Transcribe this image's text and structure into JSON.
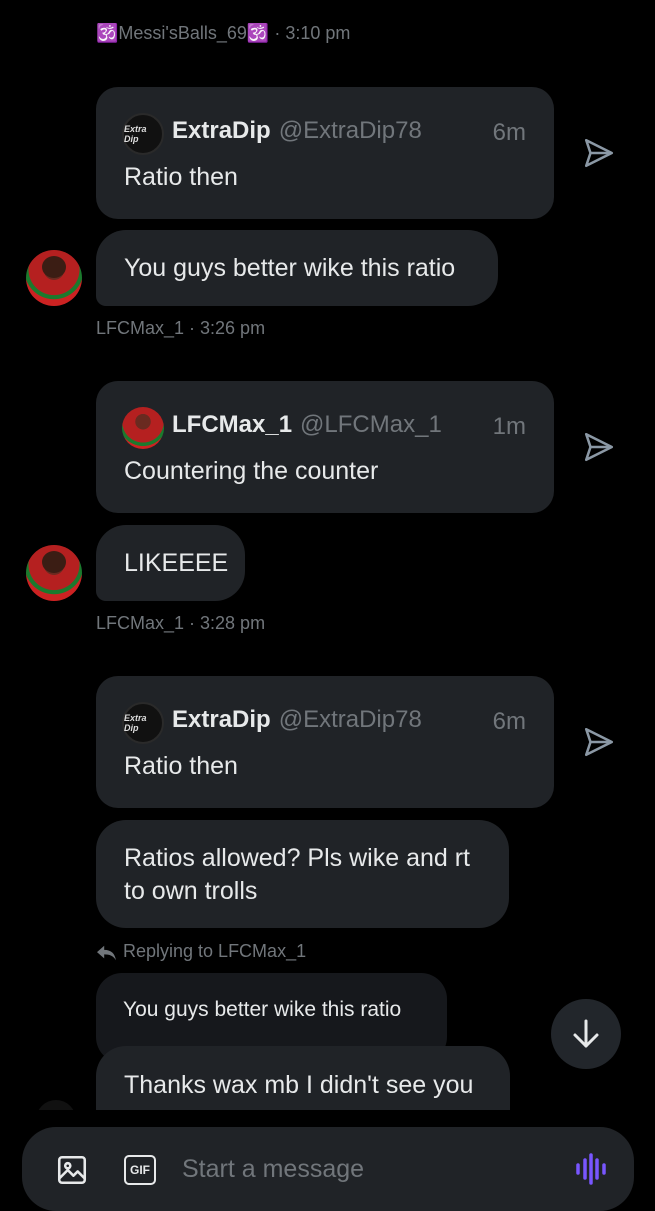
{
  "top_meta": {
    "prefix": "🕉️",
    "name": "Messi'sBalls_69",
    "suffix": "🕉️",
    "sep": " · ",
    "time": "3:10 pm"
  },
  "cards": [
    {
      "logo_text": "Extra Dip",
      "name": "ExtraDip",
      "handle": "@ExtraDip78",
      "time": "6m",
      "text": "Ratio then"
    },
    {
      "logo_text": "",
      "name": "LFCMax_1",
      "handle": "@LFCMax_1",
      "time": "1m",
      "text": "Countering the counter"
    },
    {
      "logo_text": "Extra Dip",
      "name": "ExtraDip",
      "handle": "@ExtraDip78",
      "time": "6m",
      "text": "Ratio then"
    }
  ],
  "messages": [
    {
      "text": "You guys better wike this ratio",
      "meta": "LFCMax_1 · 3:26 pm"
    },
    {
      "text": "LIKEEEE",
      "meta": "LFCMax_1 · 3:28 pm"
    },
    {
      "text": "Ratios allowed? Pls wike and rt to own trolls"
    },
    {
      "text": "Thanks wax mb I didn't see you"
    }
  ],
  "reply": {
    "label": "Replying to LFCMax_1",
    "quoted": "You guys better wike this ratio"
  },
  "composer": {
    "placeholder": "Start a message",
    "gif_label": "GIF"
  },
  "colors": {
    "accent": "#7856ff",
    "bubble": "#202327",
    "muted": "#71767b"
  }
}
